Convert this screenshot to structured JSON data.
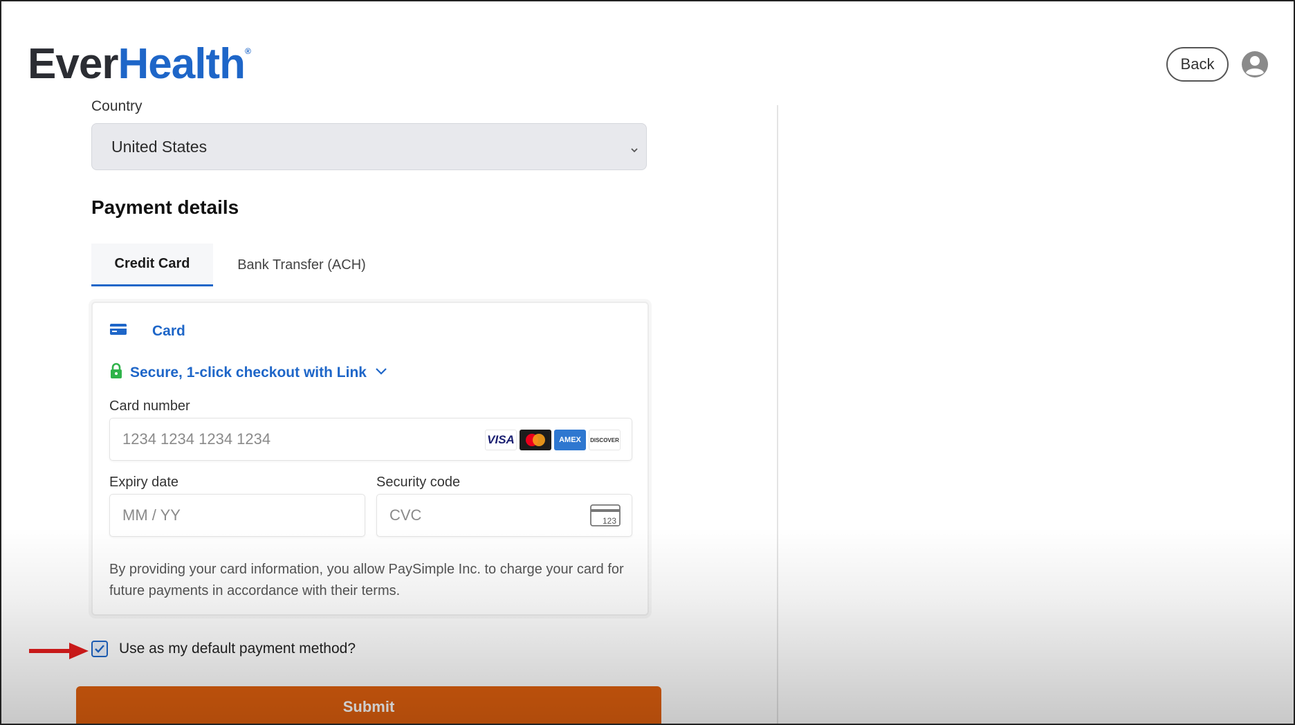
{
  "header": {
    "logo_part1": "Ever",
    "logo_part2": "Health",
    "logo_mark": "®",
    "back_label": "Back",
    "avatar_icon": "user-circle-icon"
  },
  "country": {
    "label": "Country",
    "value": "United States"
  },
  "payment": {
    "title": "Payment details",
    "tabs": [
      {
        "label": "Credit Card",
        "active": true
      },
      {
        "label": "Bank Transfer (ACH)",
        "active": false
      }
    ],
    "method_label": "Card",
    "method_icon": "credit-card-icon",
    "link_text": "Secure, 1-click checkout with Link",
    "link_icon": "lock-icon",
    "card_number": {
      "label": "Card number",
      "placeholder": "1234 1234 1234 1234",
      "brands": [
        "VISA",
        "Mastercard",
        "AMEX",
        "DISCOVER"
      ]
    },
    "expiry": {
      "label": "Expiry date",
      "placeholder": "MM / YY"
    },
    "cvc": {
      "label": "Security code",
      "placeholder": "CVC",
      "icon_text": "123"
    },
    "disclaimer": "By providing your card information, you allow PaySimple Inc. to charge your card for future payments in accordance with their terms."
  },
  "default_method": {
    "label": "Use as my default payment method?",
    "checked": true
  },
  "submit_label": "Submit",
  "colors": {
    "accent": "#1e66c8",
    "submit": "#e0600f",
    "lock": "#2fb34a",
    "annotation_arrow": "#e41e1e"
  }
}
